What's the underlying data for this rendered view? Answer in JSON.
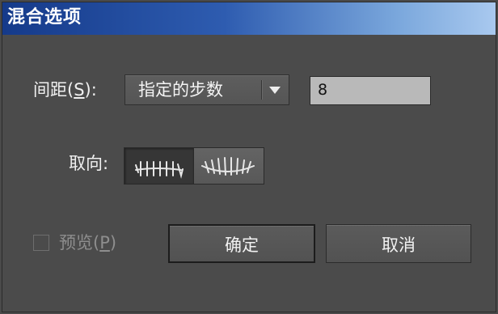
{
  "window": {
    "title": "混合选项"
  },
  "spacing": {
    "label_prefix": "间距(",
    "label_key": "S",
    "label_suffix": "):",
    "selected_option": "指定的步数",
    "steps_value": "8"
  },
  "orientation": {
    "label": "取向:",
    "options": [
      {
        "icon": "align-to-page-icon",
        "selected": true
      },
      {
        "icon": "align-to-path-icon",
        "selected": false
      }
    ]
  },
  "preview": {
    "label_prefix": "预览(",
    "label_key": "P",
    "label_suffix": ")",
    "checked": false
  },
  "buttons": {
    "ok": "确定",
    "cancel": "取消"
  },
  "colors": {
    "title_gradient_start": "#153a8a",
    "title_gradient_end": "#a9c9ef",
    "dialog_bg": "#4b4b4b"
  }
}
